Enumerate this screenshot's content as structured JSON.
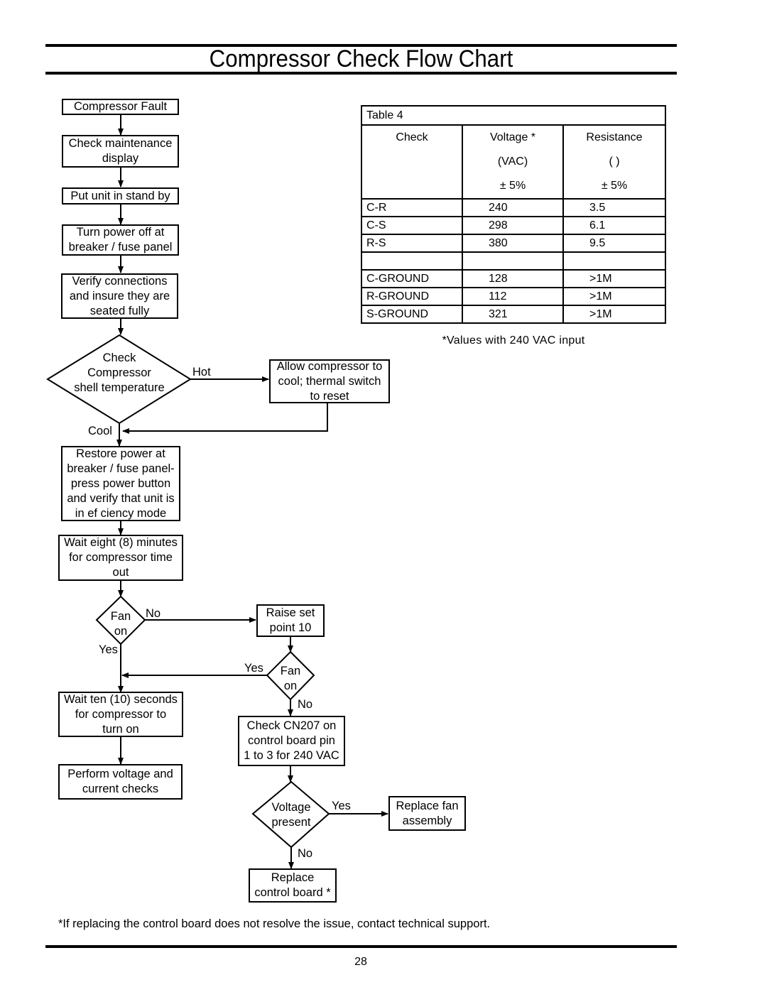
{
  "page": {
    "title": "Compressor Check Flow Chart",
    "footnote": "*If replacing the control board does not resolve the issue, contact technical support.",
    "page_number": "28"
  },
  "flow": {
    "nodes": {
      "compressor_fault": "Compressor Fault",
      "check_maintenance": "Check maintenance\ndisplay",
      "stand_by": "Put unit in stand by",
      "power_off": "Turn power off at\nbreaker / fuse panel",
      "verify_connections": "Verify connections\nand insure they are\nseated fully",
      "check_shell_temp": "Check\nCompressor\nshell temperature",
      "allow_cool": "Allow compressor to\ncool; thermal switch\nto reset",
      "restore_power": "Restore power at\nbreaker / fuse panel-\npress power button\nand verify that unit is\nin ef  ciency mode",
      "wait_eight": "Wait eight (8) minutes\nfor compressor time\nout",
      "fan_on_1": "Fan\non",
      "raise_set_point": "Raise set\npoint 10",
      "fan_on_2": "Fan\non",
      "wait_ten": "Wait ten (10) seconds\nfor compressor to\nturn on",
      "perform_checks": "Perform voltage and\ncurrent checks",
      "check_cn207": "Check CN207 on\ncontrol board pin\n1 to 3 for 240 VAC",
      "voltage_present": "Voltage\npresent",
      "replace_fan": "Replace fan\nassembly",
      "replace_board": "Replace\ncontrol board *"
    },
    "labels": {
      "hot": "Hot",
      "cool": "Cool",
      "fan1_no": "No",
      "fan1_yes": "Yes",
      "fan2_yes": "Yes",
      "fan2_no": "No",
      "voltage_yes": "Yes",
      "voltage_no": "No"
    }
  },
  "table4": {
    "caption": "Table 4",
    "headers": {
      "check": "Check",
      "voltage": [
        "Voltage *",
        "(VAC)",
        "± 5%"
      ],
      "resistance": [
        "Resistance",
        "(  )",
        "± 5%"
      ]
    },
    "rows": [
      {
        "check": "C-R",
        "voltage": "240",
        "resistance": "3.5"
      },
      {
        "check": "C-S",
        "voltage": "298",
        "resistance": "6.1"
      },
      {
        "check": "R-S",
        "voltage": "380",
        "resistance": "9.5"
      },
      {
        "check": "",
        "voltage": "",
        "resistance": ""
      },
      {
        "check": "C-GROUND",
        "voltage": "128",
        "resistance": ">1M"
      },
      {
        "check": "R-GROUND",
        "voltage": "112",
        "resistance": ">1M"
      },
      {
        "check": "S-GROUND",
        "voltage": "321",
        "resistance": ">1M"
      }
    ],
    "note": "*Values with 240 VAC input"
  }
}
